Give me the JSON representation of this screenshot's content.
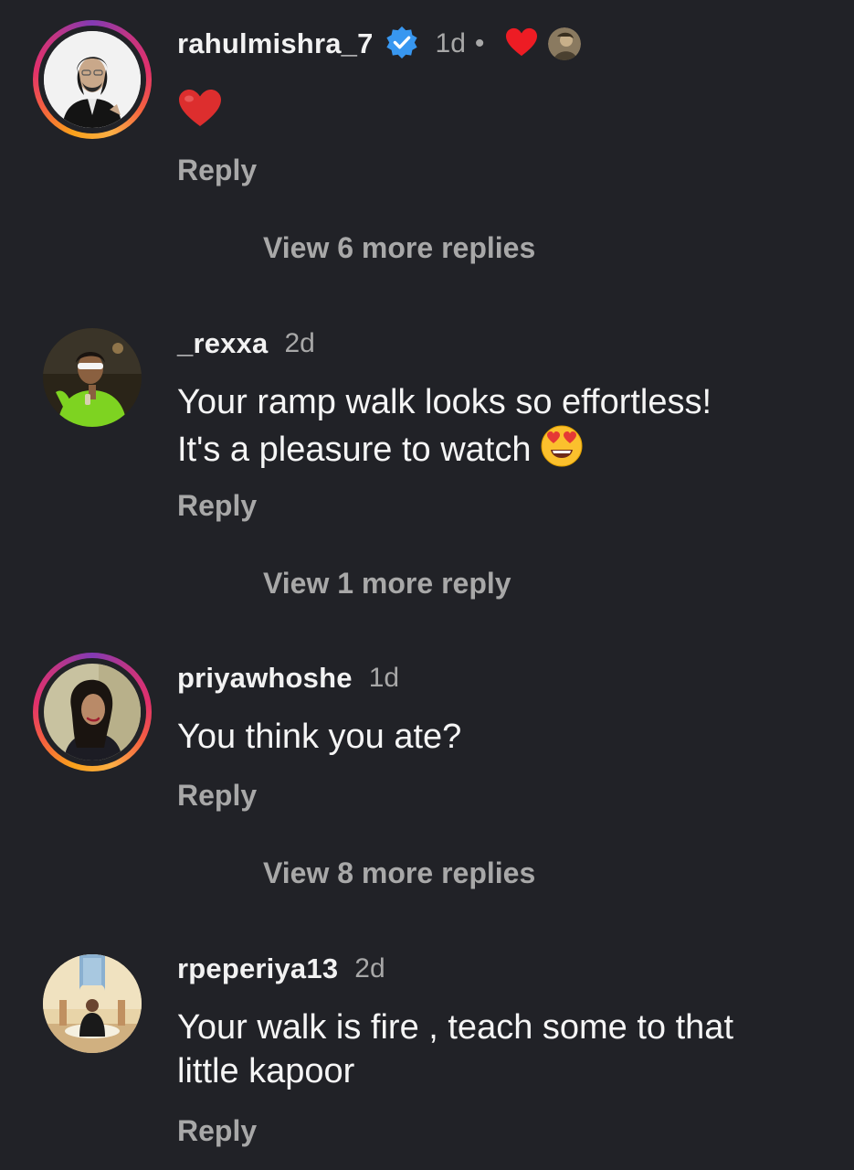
{
  "comments": [
    {
      "username": "rahulmishra_7",
      "verified": true,
      "time": "1d",
      "separator": "•",
      "body_emoji": "red-heart",
      "reply_label": "Reply",
      "view_more": "View 6 more replies"
    },
    {
      "username": "_rexxa",
      "time": "2d",
      "body_lines": [
        "Your ramp walk looks so effortless!",
        "It's a pleasure to watch"
      ],
      "body_emoji": "heart-eyes",
      "reply_label": "Reply",
      "view_more": "View 1 more reply"
    },
    {
      "username": "priyawhoshe",
      "time": "1d",
      "body_lines": [
        "You think you ate?"
      ],
      "reply_label": "Reply",
      "view_more": "View 8 more replies"
    },
    {
      "username": "rpeperiya13",
      "time": "2d",
      "body_lines": [
        "Your walk is fire , teach some to that",
        "little kapoor"
      ],
      "reply_label": "Reply"
    }
  ],
  "colors": {
    "background": "#212227",
    "primary_text": "#f5f5f5",
    "secondary_text": "#a8a8a8",
    "verified_blue": "#3897f0",
    "heart_red": "#ed1c24"
  }
}
